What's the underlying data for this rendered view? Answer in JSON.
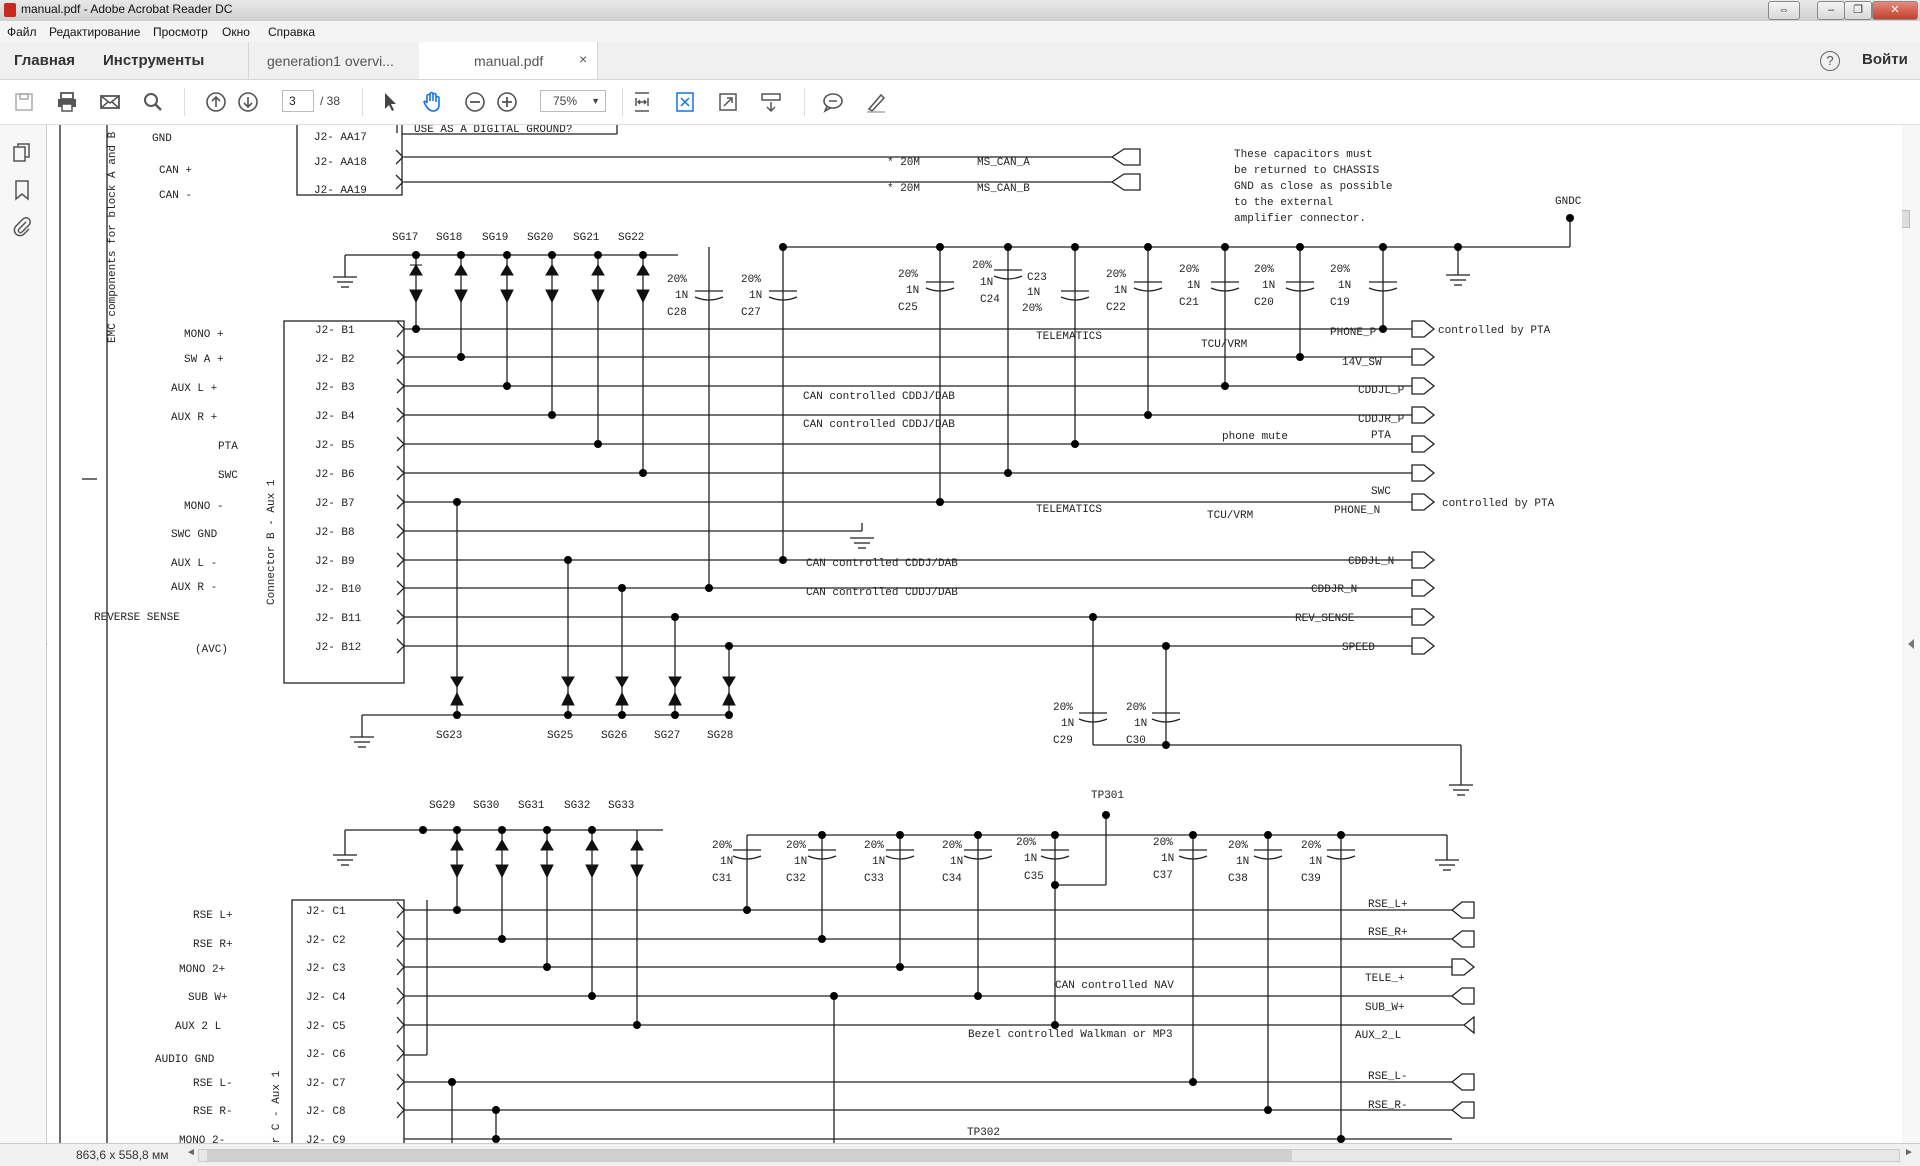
{
  "window": {
    "title": "manual.pdf - Adobe Acrobat Reader DC"
  },
  "menu": [
    "Файл",
    "Редактирование",
    "Просмотр",
    "Окно",
    "Справка"
  ],
  "nav": {
    "home": "Главная",
    "tools": "Инструменты"
  },
  "tabs": [
    {
      "label": "generation1 overvi..."
    },
    {
      "label": "manual.pdf",
      "close": "×"
    }
  ],
  "header": {
    "help": "?",
    "signin": "Войти"
  },
  "toolbar": {
    "page_current": "3",
    "page_total": "/ 38",
    "zoom": "75%"
  },
  "status": {
    "dims": "863,6 x 558,8 мм"
  },
  "schematic": {
    "top_note": "USE AS A DIGITAL GROUND?",
    "cap_note": [
      "These capacitors must",
      "be returned to CHASSIS",
      "GND as close as possible",
      "to the external",
      "amplifier connector."
    ],
    "gndc": "GNDC",
    "rot_left": "EMC components for block A and B",
    "rot_b": "Connector B - Aux 1",
    "rot_c": "or C - Aux 1",
    "aa_pins": [
      "J2- AA17",
      "J2- AA18",
      "J2- AA19"
    ],
    "aa_labels": [
      "GND",
      "CAN +",
      "CAN -"
    ],
    "aa_nets": [
      [
        "* 20M",
        "MS_CAN_A"
      ],
      [
        "* 20M",
        "MS_CAN_B"
      ]
    ],
    "b_pins": [
      "J2- B1",
      "J2- B2",
      "J2- B3",
      "J2- B4",
      "J2- B5",
      "J2- B6",
      "J2- B7",
      "J2- B8",
      "J2- B9",
      "J2- B10",
      "J2- B11",
      "J2- B12"
    ],
    "b_labels": [
      "MONO +",
      "SW A +",
      "AUX L +",
      "AUX R +",
      "PTA",
      "SWC",
      "MONO -",
      "SWC GND",
      "AUX L -",
      "AUX R -",
      "REVERSE SENSE",
      "(AVC)"
    ],
    "sg_top": [
      "SG17",
      "SG18",
      "SG19",
      "SG20",
      "SG21",
      "SG22"
    ],
    "sg_bot": [
      "SG23",
      "SG25",
      "SG26",
      "SG27",
      "SG28"
    ],
    "caps_top": [
      {
        "p": "20%",
        "v": "1N",
        "n": "C28"
      },
      {
        "p": "20%",
        "v": "1N",
        "n": "C27"
      },
      {
        "p": "20%",
        "v": "1N",
        "n": "C25"
      },
      {
        "p": "20%",
        "v": "1N",
        "n": "C24"
      },
      {
        "p": "C23",
        "v": "1N",
        "n": "20%"
      },
      {
        "p": "20%",
        "v": "1N",
        "n": "C22"
      },
      {
        "p": "20%",
        "v": "1N",
        "n": "C21"
      },
      {
        "p": "20%",
        "v": "1N",
        "n": "C20"
      },
      {
        "p": "20%",
        "v": "1N",
        "n": "C19"
      }
    ],
    "caps_mid": [
      {
        "p": "20%",
        "v": "1N",
        "n": "C29"
      },
      {
        "p": "20%",
        "v": "1N",
        "n": "C30"
      }
    ],
    "b_nets": [
      "PHONE_P",
      "14V_SW",
      "CDDJL_P",
      "CDDJR_P",
      "PTA",
      "SWC",
      "PHONE_N",
      "CDDJL_N",
      "CDDJR_N",
      "REV_SENSE",
      "SPEED"
    ],
    "b_notes": [
      "controlled by PTA",
      "controlled by PTA",
      "CAN controlled CDDJ/DAB",
      "CAN controlled CDDJ/DAB",
      "CAN controlled CDDJ/DAB",
      "CAN controlled CDDJ/DAB",
      "TELEMATICS",
      "TCU/VRM",
      "TELEMATICS",
      "TCU/VRM",
      "phone mute"
    ],
    "c_pins": [
      "J2- C1",
      "J2- C2",
      "J2- C3",
      "J2- C4",
      "J2- C5",
      "J2- C6",
      "J2- C7",
      "J2- C8",
      "J2- C9"
    ],
    "c_labels": [
      "RSE L+",
      "RSE R+",
      "MONO 2+",
      "SUB W+",
      "AUX 2 L",
      "AUDIO GND",
      "RSE L-",
      "RSE R-",
      "MONO 2-"
    ],
    "sg_c": [
      "SG29",
      "SG30",
      "SG31",
      "SG32",
      "SG33"
    ],
    "caps_c": [
      {
        "p": "20%",
        "v": "1N",
        "n": "C31"
      },
      {
        "p": "20%",
        "v": "1N",
        "n": "C32"
      },
      {
        "p": "20%",
        "v": "1N",
        "n": "C33"
      },
      {
        "p": "20%",
        "v": "1N",
        "n": "C34"
      },
      {
        "p": "20%",
        "v": "1N",
        "n": "C35"
      },
      {
        "p": "20%",
        "v": "1N",
        "n": "C37"
      },
      {
        "p": "20%",
        "v": "1N",
        "n": "C38"
      },
      {
        "p": "20%",
        "v": "1N",
        "n": "C39"
      }
    ],
    "tp": [
      "TP301",
      "TP302"
    ],
    "c_nets": [
      "RSE_L+",
      "RSE_R+",
      "TELE_+",
      "SUB_W+",
      "AUX_2_L",
      "RSE_L-",
      "RSE_R-"
    ],
    "c_notes": [
      "CAN controlled NAV",
      "Bezel controlled Walkman or MP3"
    ]
  }
}
